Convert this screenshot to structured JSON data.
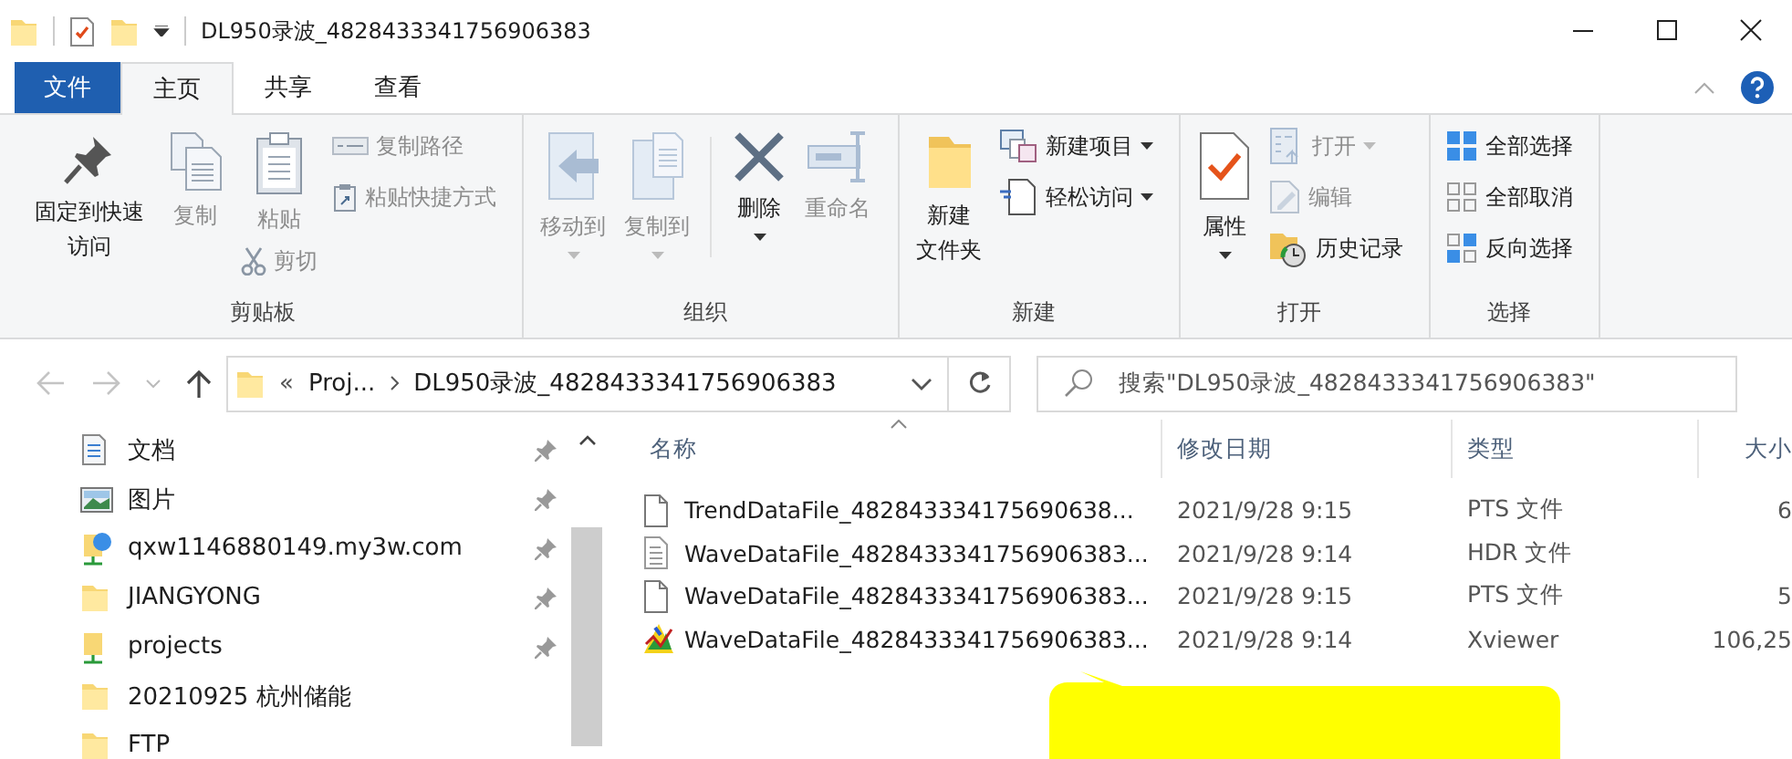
{
  "window": {
    "title": "DL950录波_4828433341756906383"
  },
  "ribbon": {
    "tabs": [
      {
        "label": "文件",
        "kind": "file",
        "selected": false
      },
      {
        "label": "主页",
        "kind": "tab",
        "selected": true
      },
      {
        "label": "共享",
        "kind": "tab",
        "selected": false
      },
      {
        "label": "查看",
        "kind": "tab",
        "selected": false
      }
    ],
    "groups": [
      {
        "label": "剪贴板",
        "columns": [
          {
            "items": [
              {
                "label": "固定到快速访问",
                "kind": "large",
                "disabled": false
              }
            ]
          },
          {
            "items": [
              {
                "label": "复制",
                "kind": "large",
                "disabled": true
              }
            ]
          },
          {
            "items": [
              {
                "label": "粘贴",
                "kind": "large",
                "disabled": true
              },
              {
                "label": "剪切",
                "kind": "small",
                "disabled": true
              }
            ]
          },
          {
            "items": [
              {
                "label": "复制路径",
                "kind": "small",
                "disabled": true
              },
              {
                "label": "粘贴快捷方式",
                "kind": "small",
                "disabled": true
              }
            ]
          }
        ]
      },
      {
        "label": "组织",
        "columns": [
          {
            "items": [
              {
                "label": "移动到",
                "kind": "large",
                "disabled": true,
                "dropdown": true
              }
            ]
          },
          {
            "items": [
              {
                "label": "复制到",
                "kind": "large",
                "disabled": true,
                "dropdown": true
              }
            ]
          },
          {
            "divider": true,
            "items": [
              {
                "label": "删除",
                "kind": "large",
                "disabled": false,
                "dropdown": true
              }
            ]
          },
          {
            "items": [
              {
                "label": "重命名",
                "kind": "large",
                "disabled": true
              }
            ]
          }
        ]
      },
      {
        "label": "新建",
        "columns": [
          {
            "items": [
              {
                "label_lines": [
                  "新建",
                  "文件夹"
                ],
                "kind": "large",
                "disabled": false
              }
            ]
          },
          {
            "items": [
              {
                "label": "新建项目",
                "kind": "small",
                "disabled": false,
                "dropdown": true
              },
              {
                "label": "轻松访问",
                "kind": "small",
                "disabled": false,
                "dropdown": true
              }
            ]
          }
        ]
      },
      {
        "label": "打开",
        "columns": [
          {
            "items": [
              {
                "label": "属性",
                "kind": "large",
                "disabled": false,
                "dropdown": true
              }
            ]
          },
          {
            "items": [
              {
                "label": "打开",
                "kind": "small",
                "disabled": true,
                "dropdown": true
              },
              {
                "label": "编辑",
                "kind": "small",
                "disabled": true
              },
              {
                "label": "历史记录",
                "kind": "small",
                "disabled": false
              }
            ]
          }
        ]
      },
      {
        "label": "选择",
        "columns": [
          {
            "items": [
              {
                "label": "全部选择",
                "kind": "small",
                "disabled": false
              },
              {
                "label": "全部取消",
                "kind": "small",
                "disabled": false
              },
              {
                "label": "反向选择",
                "kind": "small",
                "disabled": false
              }
            ]
          }
        ]
      }
    ]
  },
  "address_bar": {
    "back_disabled": true,
    "forward_disabled": true,
    "overflow": "«",
    "crumbs": [
      "Proj...",
      "DL950录波_4828433341756906383"
    ]
  },
  "search": {
    "placeholder": "搜索\"DL950录波_4828433341756906383\""
  },
  "navigation_pane": {
    "items": [
      {
        "label": "文档",
        "kind": "documents",
        "pinned": true
      },
      {
        "label": "图片",
        "kind": "pictures",
        "pinned": true
      },
      {
        "label": "qxw1146880149.my3w.com",
        "kind": "network",
        "pinned": true
      },
      {
        "label": "JIANGYONG",
        "kind": "folder",
        "pinned": true
      },
      {
        "label": "projects",
        "kind": "network_folder",
        "pinned": true
      },
      {
        "label": "20210925 杭州储能",
        "kind": "folder",
        "pinned": false
      },
      {
        "label": "FTP",
        "kind": "folder",
        "pinned": false
      }
    ]
  },
  "file_list": {
    "columns": [
      "名称",
      "修改日期",
      "类型",
      "大小"
    ],
    "rows": [
      {
        "name": "TrendDataFile_482843334175690638...",
        "date": "2021/9/28 9:15",
        "type": "PTS 文件",
        "size": "6",
        "kind": "blank"
      },
      {
        "name": "WaveDataFile_4828433341756906383...",
        "date": "2021/9/28 9:14",
        "type": "HDR 文件",
        "kind": "text"
      },
      {
        "name": "WaveDataFile_4828433341756906383...",
        "date": "2021/9/28 9:15",
        "type": "PTS 文件",
        "size": "5",
        "kind": "blank"
      },
      {
        "name": "WaveDataFile_4828433341756906383...",
        "date": "2021/9/28 9:14",
        "type": "Xviewer",
        "size": "106,25",
        "kind": "xviewer"
      }
    ]
  },
  "annotation": {
    "kind": "callout"
  }
}
